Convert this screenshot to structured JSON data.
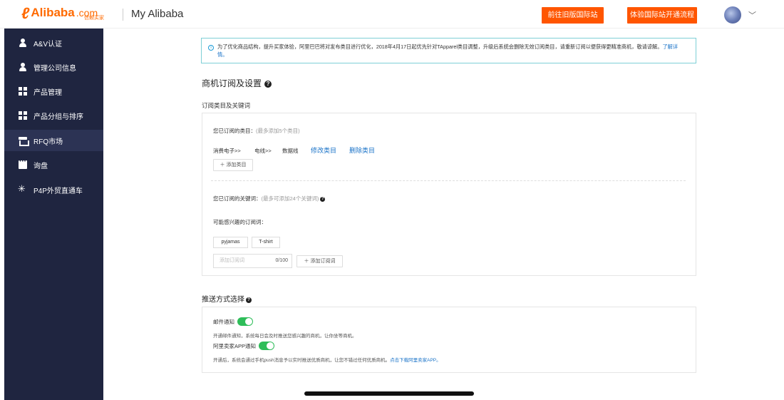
{
  "header": {
    "logo_text": "Alibaba",
    "logo_com": ".com",
    "logo_sub": "信赖买家",
    "title": "My Alibaba",
    "btn_intl": "前往旧版国际站",
    "btn_flow": "体验国际站开通流程"
  },
  "sidebar": {
    "items": [
      {
        "label": "A&V认证",
        "icon": "user-badge-icon"
      },
      {
        "label": "管理公司信息",
        "icon": "user-icon"
      },
      {
        "label": "产品管理",
        "icon": "grid-icon"
      },
      {
        "label": "产品分组与排序",
        "icon": "grid-icon"
      },
      {
        "label": "RFQ市场",
        "icon": "rfq-icon"
      },
      {
        "label": "询盘",
        "icon": "chat-icon"
      },
      {
        "label": "P4P外贸直通车",
        "icon": "sparkle-icon"
      }
    ],
    "active": "RFQ市场"
  },
  "notice": {
    "text": "为了优化商品结构，提升买家体验，阿里巴巴将对发布类目进行优化，2018年4月17日起优先针对TApparel类目调整，升级后系统会删除无效订阅类目，请重新订阅以便获得更精准商机，敬请谅解。",
    "link": "了解详情。"
  },
  "subscription": {
    "section_title": "商机订阅及设置",
    "category_keyword_title": "订阅类目及关键词",
    "subscribed_categories_label": "您已订阅的类目：",
    "subscribed_categories_hint": "(最多添加5个类目)",
    "category_path": [
      "消费电子>>",
      "电线>>",
      "数据线"
    ],
    "edit_category": "修改类目",
    "delete_category": "删除类目",
    "add_category": "＋ 添加类目",
    "subscribed_keywords_label": "您已订阅的关键词：",
    "subscribed_keywords_hint": "(最多可添加24个关键词)",
    "suggested_keywords_label": "可能感兴趣的订阅词：",
    "suggested_keywords": [
      "pyjamas",
      "T-shirt"
    ],
    "keyword_placeholder": "添加订阅词",
    "keyword_count": "0/100",
    "add_keyword": "＋ 添加订阅词"
  },
  "push": {
    "section_title": "推送方式选择",
    "email_label": "邮件通知",
    "email_on": true,
    "email_desc": "开通邮件通知，系统每日会及时推送您感兴趣的商机，让你坐等商机。",
    "app_label": "阿里卖家APP通知",
    "app_on": true,
    "app_desc": "开通后，系统会通过手机push消息予以实时推送优质商机，让您不错过任何优质商机。",
    "app_link": "点击下载阿里卖家APP。"
  },
  "colors": {
    "brand_orange": "#ff6a00",
    "button_orange": "#ff5500",
    "sidebar_bg": "#1f2540",
    "toggle_green": "#2ebd59",
    "link_blue": "#1a73c8"
  }
}
